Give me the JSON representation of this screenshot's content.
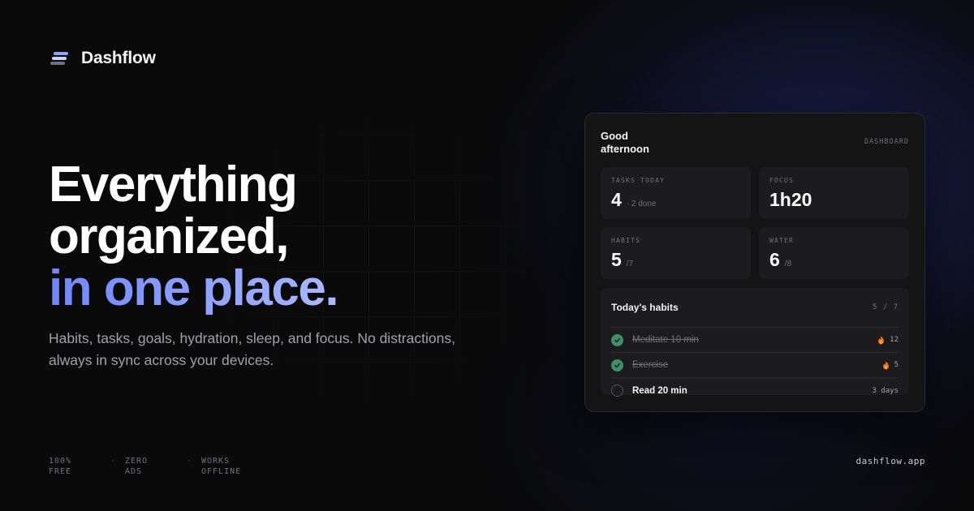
{
  "brand": {
    "name": "Dashflow"
  },
  "hero": {
    "line1": "Everything",
    "line2": "organized,",
    "line3": "in one place.",
    "subtitle": "Habits, tasks, goals, hydration, sleep, and focus. No distractions, always in sync across your devices."
  },
  "features": [
    {
      "line1": "100%",
      "line2": "FREE"
    },
    {
      "line1": "ZERO",
      "line2": "ADS"
    },
    {
      "line1": "WORKS",
      "line2": "OFFLINE"
    }
  ],
  "feature_separator": "·",
  "site": "dashflow.app",
  "card": {
    "greeting": "Good afternoon",
    "label": "DASHBOARD",
    "stats": [
      {
        "label": "TASKS TODAY",
        "value": "4",
        "sub": "· 2 done"
      },
      {
        "label": "FOCUS",
        "value": "1h20",
        "sub": ""
      },
      {
        "label": "HABITS",
        "value": "5",
        "sub": "/7"
      },
      {
        "label": "WATER",
        "value": "6",
        "sub": "/8"
      }
    ],
    "habits": {
      "title": "Today's habits",
      "count": "5 / 7",
      "items": [
        {
          "name": "Meditate 10 min",
          "done": true,
          "meta": "12"
        },
        {
          "name": "Exercise",
          "done": true,
          "meta": "5"
        },
        {
          "name": "Read 20 min",
          "done": false,
          "meta": "3 days"
        }
      ]
    }
  },
  "colors": {
    "accent": "#7c93ff",
    "success": "#3f8f6b",
    "flame": "#f97316"
  }
}
